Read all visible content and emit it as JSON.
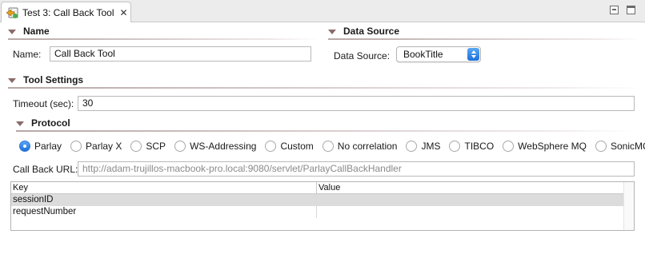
{
  "tab": {
    "title": "Test 3: Call Back Tool",
    "close_glyph": "✕",
    "icon": "test-tool-icon"
  },
  "window": {
    "minimize_icon": "minimize-icon",
    "maximize_icon": "maximize-icon"
  },
  "name_section": {
    "title": "Name",
    "name_label": "Name:",
    "name_value": "Call Back Tool"
  },
  "data_source_section": {
    "title": "Data Source",
    "label": "Data Source:",
    "selected": "BookTitle"
  },
  "tool_settings": {
    "title": "Tool Settings",
    "timeout_label": "Timeout (sec):",
    "timeout_value": "30"
  },
  "protocol": {
    "title": "Protocol",
    "options": [
      "Parlay",
      "Parlay X",
      "SCP",
      "WS-Addressing",
      "Custom",
      "No correlation",
      "JMS",
      "TIBCO",
      "WebSphere MQ",
      "SonicMQ"
    ],
    "selected": "Parlay",
    "callback_url_label": "Call Back URL:",
    "callback_url_value": "http://adam-trujillos-macbook-pro.local:9080/servlet/ParlayCallBackHandler"
  },
  "table": {
    "columns": [
      "Key",
      "Value"
    ],
    "rows": [
      {
        "key": "sessionID",
        "value": ""
      },
      {
        "key": "requestNumber",
        "value": ""
      }
    ],
    "selected_row": "sessionID"
  },
  "colors": {
    "accent": "#1e6fd9",
    "section_twisty": "#8c6a6a",
    "selected_row": "#dcdcdc"
  }
}
